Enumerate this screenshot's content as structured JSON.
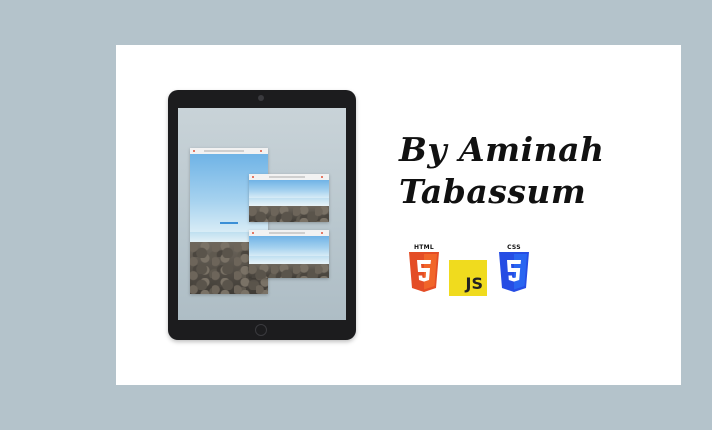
{
  "author_line1": "By Aminah",
  "author_line2": "Tabassum",
  "badges": {
    "html": "HTML",
    "js": "JS",
    "css": "CSS"
  },
  "colors": {
    "background": "#b4c3cb",
    "card": "#ffffff",
    "html5": "#e44d26",
    "js": "#f0db1e",
    "css3": "#264de4"
  },
  "icons": [
    "html5-icon",
    "javascript-icon",
    "css3-icon"
  ]
}
